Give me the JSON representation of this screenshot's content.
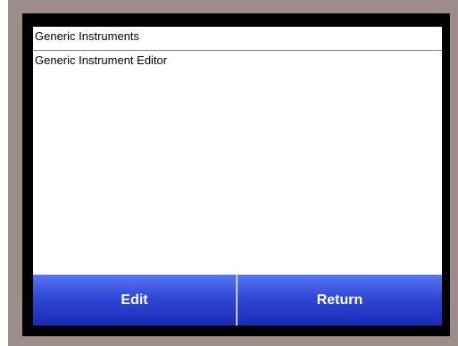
{
  "window": {
    "title": "Generic Instruments"
  },
  "list": {
    "items": [
      {
        "label": "Generic Instrument Editor"
      }
    ]
  },
  "buttons": {
    "edit_label": "Edit",
    "return_label": "Return"
  },
  "colors": {
    "bezel": "#9c8d8b",
    "button_top": "#5877f2",
    "button_bottom": "#1c2ab6"
  }
}
